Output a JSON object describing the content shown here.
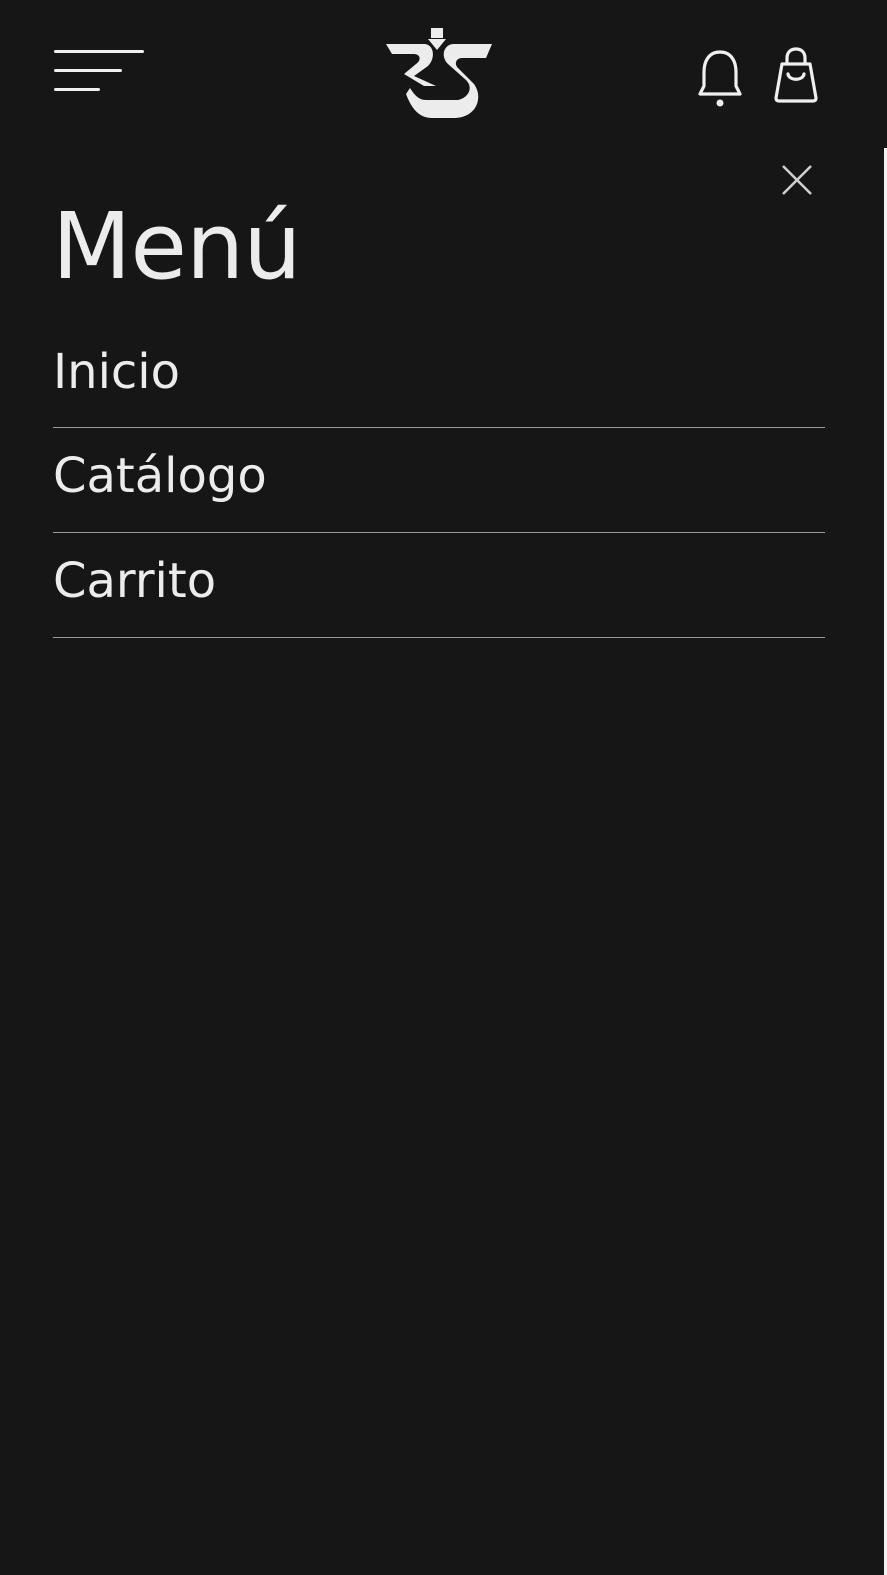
{
  "header": {
    "menu_icon": "hamburger-icon",
    "logo_icon": "brand-logo",
    "notifications_icon": "bell-icon",
    "cart_icon": "shopping-bag-icon"
  },
  "drawer": {
    "close_icon": "close-icon",
    "title": "Menú",
    "items": [
      {
        "label": "Inicio"
      },
      {
        "label": "Catálogo"
      },
      {
        "label": "Carrito"
      }
    ]
  },
  "colors": {
    "background": "#161616",
    "foreground": "#ececec",
    "divider": "#9a9a9a"
  }
}
